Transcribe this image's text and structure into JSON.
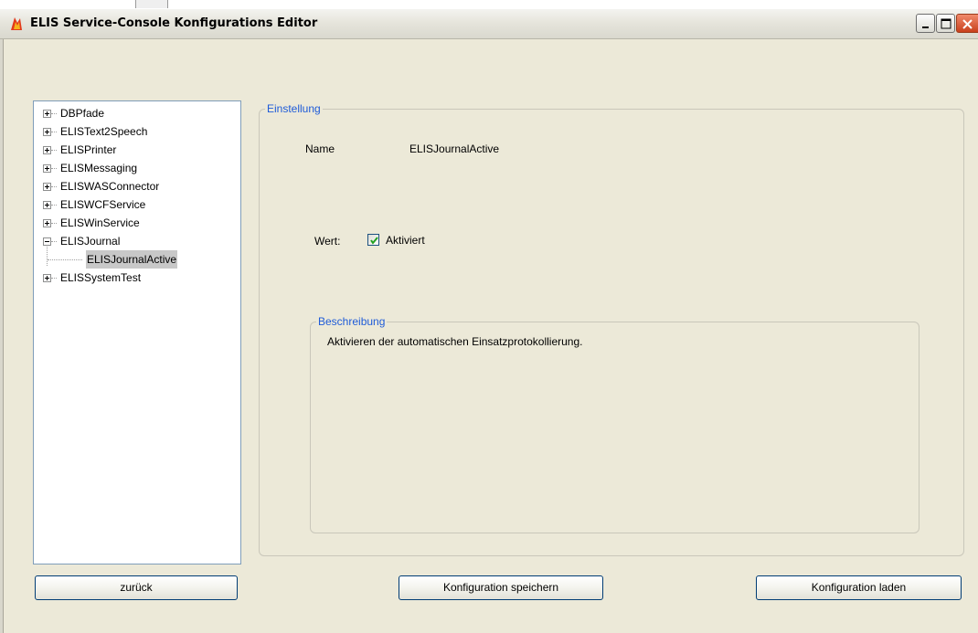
{
  "window": {
    "title": "ELIS Service-Console Konfigurations Editor",
    "icon": "elis-app-icon",
    "controls": [
      "minimize-icon",
      "maximize-icon",
      "close-icon"
    ]
  },
  "tree": {
    "items": [
      {
        "label": "DBPfade",
        "expanded": false
      },
      {
        "label": "ELISText2Speech",
        "expanded": false
      },
      {
        "label": "ELISPrinter",
        "expanded": false
      },
      {
        "label": "ELISMessaging",
        "expanded": false
      },
      {
        "label": "ELISWASConnector",
        "expanded": false
      },
      {
        "label": "ELISWCFService",
        "expanded": false
      },
      {
        "label": "ELISWinService",
        "expanded": false
      },
      {
        "label": "ELISJournal",
        "expanded": true
      },
      {
        "label": "ELISJournalActive",
        "child": true,
        "selected": true
      },
      {
        "label": "ELISSystemTest",
        "expanded": false
      }
    ]
  },
  "einstellung": {
    "legend": "Einstellung",
    "name_label": "Name",
    "name_value": "ELISJournalActive",
    "wert_label": "Wert:",
    "checkbox_label": "Aktiviert",
    "checked": true
  },
  "beschreibung": {
    "legend": "Beschreibung",
    "text": "Aktivieren der automatischen Einsatzprotokollierung."
  },
  "buttons": {
    "back": "zurück",
    "save": "Konfiguration speichern",
    "load": "Konfiguration laden"
  },
  "colors": {
    "legend_text": "#1e5bd8",
    "window_bg": "#ece9d8"
  }
}
